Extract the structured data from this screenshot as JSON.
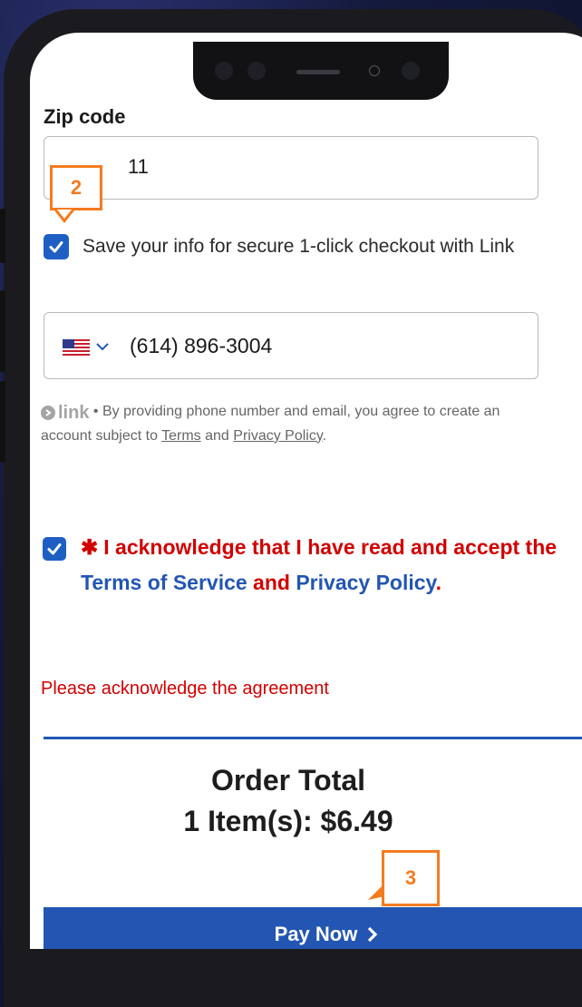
{
  "form": {
    "zip_label": "Zip code",
    "zip_value": "11",
    "save_info_text": "Save your info for secure 1-click checkout with Link",
    "phone_value": "(614) 896-3004",
    "link_brand": "link",
    "link_note_prefix": "• By providing phone number and email, you agree to create an account subject to ",
    "link_terms": "Terms",
    "link_and": " and ",
    "link_privacy": "Privacy Policy",
    "link_period": "."
  },
  "agreement": {
    "asterisk": "✱",
    "text_part1": "I acknowledge that I have read and accept the ",
    "terms_link": "Terms of Service",
    "and_text": " and ",
    "privacy_link": "Privacy Policy",
    "period": ".",
    "error": "Please acknowledge the agreement"
  },
  "order": {
    "title": "Order Total",
    "items": "1 Item(s): $6.49",
    "pay_label": "Pay Now"
  },
  "annotations": {
    "step2": "2",
    "step3": "3"
  },
  "colors": {
    "accent_blue": "#2356b3",
    "checkbox_blue": "#1f5fc4",
    "error_red": "#d20000",
    "annotation_orange": "#f47b20"
  },
  "icons": [
    "check-icon",
    "us-flag-icon",
    "chevron-down-icon",
    "link-logo-icon",
    "chevron-right-icon"
  ]
}
